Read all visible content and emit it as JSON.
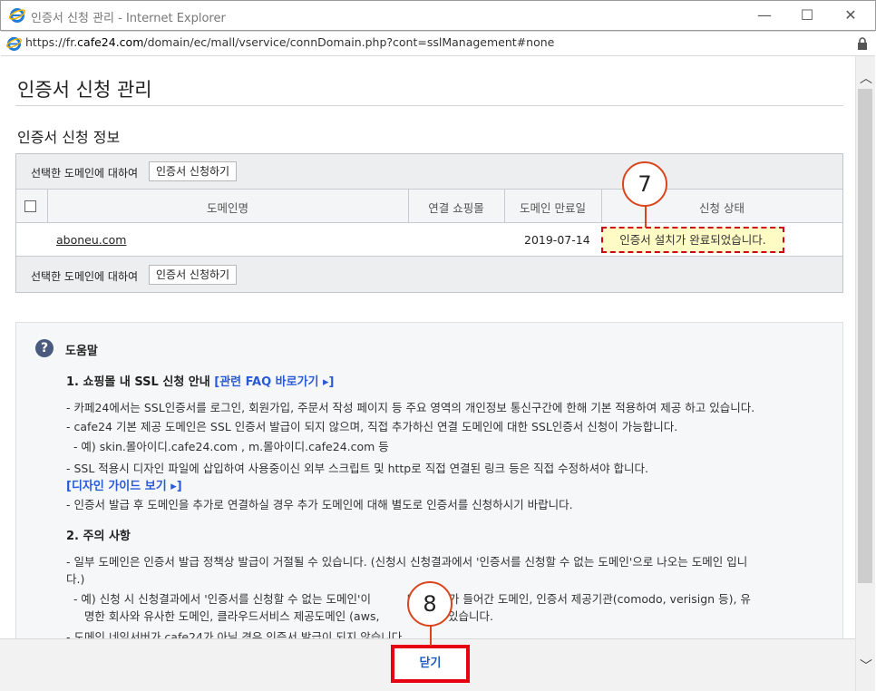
{
  "window": {
    "title": "인증서 신청 관리 - Internet Explorer",
    "url_prefix": "https://fr.",
    "url_domain": "cafe24.com",
    "url_rest": "/domain/ec/mall/vservice/connDomain.php?cont=sslManagement#none",
    "minimize": "—",
    "maximize": "☐",
    "close": "✕"
  },
  "page": {
    "title": "인증서 신청 관리",
    "section_title": "인증서 신청 정보"
  },
  "table": {
    "bar_label": "선택한 도메인에 대하여",
    "apply_button": "인증서 신청하기",
    "columns": [
      "도메인명",
      "연결 쇼핑몰",
      "도메인 만료일",
      "신청 상태"
    ],
    "rows": [
      {
        "domain": "aboneu.com",
        "shop": "",
        "expiry": "2019-07-14",
        "status": "인증서 설치가 완료되었습니다."
      }
    ]
  },
  "callouts": {
    "status": "7",
    "close": "8"
  },
  "help": {
    "title": "도움말",
    "s1_heading": "1. 쇼핑몰 내 SSL 신청 안내",
    "s1_link": "[관련 FAQ 바로가기 ▸]",
    "s1_lines": [
      "- 카페24에서는 SSL인증서를 로그인, 회원가입, 주문서 작성 페이지 등 주요 영역의 개인정보 통신구간에 한해 기본 적용하여 제공 하고 있습니다.",
      "- cafe24 기본 제공 도메인은 SSL 인증서 발급이 되지 않으며, 직접 추가하신 연결 도메인에 대한 SSL인증서 신청이 가능합니다.",
      "  - 예) skin.몰아이디.cafe24.com , m.몰아이디.cafe24.com 등",
      "- SSL 적용시 디자인 파일에 삽입하여 사용중이신 외부 스크립트 및 http로 직접 연결된 링크 등은 직접 수정하셔야 합니다."
    ],
    "design_link": "[디자인 가이드 보기 ▸]",
    "s1_last": "- 인증서 발급 후 도메인을 추가로 연결하실 경우 추가 도메인에 대해 별도로 인증서를 신청하시기 바랍니다.",
    "s2_heading": "2. 주의 사항",
    "s2_lines": [
      "- 일부 도메인은 인증서 발급 정책상 발급이 거절될 수 있습니다. (신청시 신청결과에서 '인증서를 신청할 수 없는 도메인'으로 나오는 도메인 입니",
      "다.)",
      "  - 예) 신청 시 신청결과에서 '인증서를 신청할 수 없는 도메인'이          며 bank가 들어간 도메인, 인증서 제공기관(comodo, verisign 등), 유",
      "     명한 회사와 유사한 도메인, 클라우드서비스 제공도메인 (aws,          ) 등이 있습니다.",
      "- 도메인 네임서버가 cafe24가 아닐 경우 인증서 발급이 되지 않습니다."
    ]
  },
  "footer": {
    "close_button": "닫기"
  },
  "colors": {
    "accent_blue": "#2a5bd7",
    "highlight_red": "#e60012",
    "callout_orange": "#d9461c",
    "status_bg": "#fffbc5"
  }
}
